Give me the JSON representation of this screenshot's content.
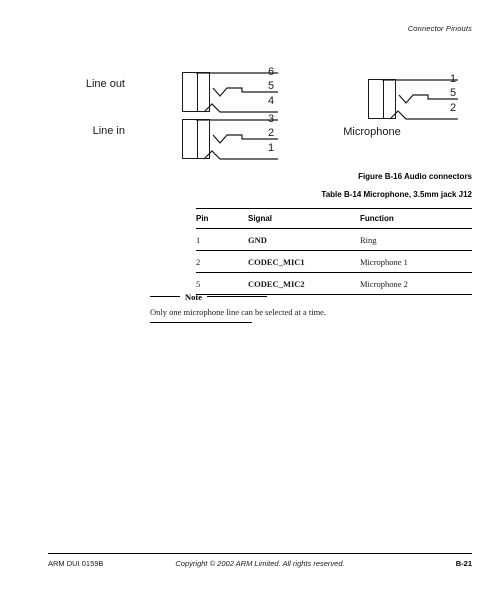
{
  "header": {
    "running_head": "Connector Pinouts"
  },
  "figure": {
    "caption": "Figure B-16 Audio connectors",
    "connectors": [
      {
        "label": "Line out",
        "label_position": "left",
        "pins": [
          "6",
          "5",
          "4"
        ]
      },
      {
        "label": "Line in",
        "label_position": "left",
        "pins": [
          "3",
          "2",
          "1"
        ]
      },
      {
        "label": "Microphone",
        "label_position": "below",
        "pins": [
          "1",
          "5",
          "2"
        ]
      }
    ]
  },
  "table": {
    "caption": "Table B-14 Microphone, 3.5mm jack J12",
    "columns": [
      "Pin",
      "Signal",
      "Function"
    ],
    "rows": [
      {
        "pin": "1",
        "signal": "GND",
        "function": "Ring"
      },
      {
        "pin": "2",
        "signal": "CODEC_MIC1",
        "function": "Microphone 1"
      },
      {
        "pin": "5",
        "signal": "CODEC_MIC2",
        "function": "Microphone 2"
      }
    ]
  },
  "note": {
    "label": "Note",
    "text": "Only one microphone line can be selected at a time."
  },
  "footer": {
    "document_id": "ARM DUI 0159B",
    "copyright": "Copyright © 2002 ARM Limited. All rights reserved.",
    "page_number": "B-21"
  },
  "colors": {
    "ink": "#000000",
    "line": "#1a1a1a",
    "page": "#ffffff"
  }
}
